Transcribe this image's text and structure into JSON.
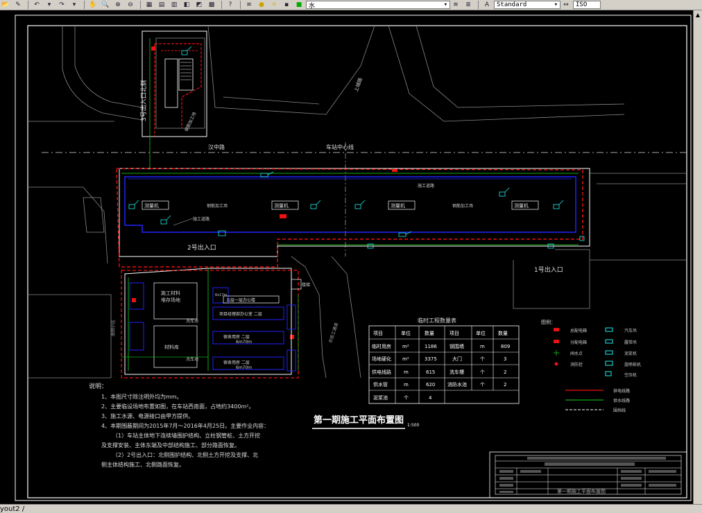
{
  "toolbar": {
    "layer_value": "水",
    "textstyle_value": "Standard",
    "dimstyle_value": "ISO",
    "icons": [
      "open-icon",
      "undo-icon",
      "redo-icon",
      "pan-icon",
      "zoom-realtime-icon",
      "zoom-window-icon",
      "zoom-previous-icon",
      "properties-icon",
      "design-center-icon",
      "tool-palettes-icon",
      "sheet-set-icon",
      "markup-icon",
      "calc-icon",
      "help-icon",
      "layer-manager-icon",
      "layer-state-icons",
      "layer-dropdown",
      "match-icon",
      "style-icon"
    ]
  },
  "status": {
    "layout_tab": "yout2"
  },
  "drawing": {
    "road_north": "汉中路",
    "station_center": "车站中心线",
    "road_east": "上城路",
    "exit3_label": "3号出入口北侧",
    "exit3_inner": "钢筋加工场",
    "exit2_label": "2号出入口",
    "exit1_label": "1号出入口",
    "west_label": "夹心墙区",
    "hall_label": "西侧出入口",
    "room_1": "测量机",
    "room_2": "测量机",
    "room_3": "测量机",
    "room_4": "测量机",
    "work_area_w": "钢筋加工场",
    "work_area_e": "钢筋加工场",
    "pipe_label_1": "施工道路",
    "pipe_label_2": "施工道路",
    "material_yard": "施工材料\n堆存场地",
    "material_store": "材料库",
    "car_wash": "洗车池",
    "office_title": "五层一层办公楼",
    "office_1": "项目经理部办公室 二层",
    "office_2": "宿舍用房   二层",
    "office_2_dim": "6m70m",
    "office_3": "宿舍用房   二层",
    "office_3_dim": "6m70m",
    "small_room": "6x17m",
    "gate_label": "大门",
    "stair": "楼梯",
    "side_label": "南侧小区",
    "road_side": "农民工通道",
    "east_shed": "工具房",
    "ramp": "斜坡道",
    "shed_left": "6m70m",
    "shed_mid": "6m70m"
  },
  "notes": {
    "title": "说明：",
    "items": [
      "1、本图尺寸除注明外均为mm。",
      "2、主要临设场地布置如图，在车站西南面，占地约3400m²。",
      "3、施工水源、电源接口由甲方提供。",
      "4、本期围蔽期间为2015年7月～2016年4月25日。主要作业内容：",
      "（1）车站主体地下连续墙围护结构、立柱钢管桩、土方开挖",
      "及支撑安装、主体东端及中部结构施工、部分路面恢复。",
      "（2）2号出入口：北侧围护结构、北侧土方开挖及支撑、北",
      "侧主体结构施工、北侧路面恢复。"
    ]
  },
  "main_title": "第一期施工平面布置图",
  "scale": "1:500",
  "table": {
    "title": "临时工程数量表",
    "headers": [
      "项目",
      "单位",
      "数量",
      "项目",
      "单位",
      "数量"
    ],
    "rows": [
      [
        "临时用房",
        "m²",
        "1186",
        "钢围墙",
        "m",
        "809"
      ],
      [
        "场地硬化",
        "m²",
        "3375",
        "大门",
        "个",
        "3"
      ],
      [
        "供电线路",
        "m",
        "615",
        "洗车槽",
        "个",
        "2"
      ],
      [
        "供水管",
        "m",
        "620",
        "消防水池",
        "个",
        "2"
      ],
      [
        "泥浆池",
        "个",
        "4",
        "",
        "",
        ""
      ]
    ]
  },
  "legend": {
    "title": "图例：",
    "items_left": [
      "总配电箱",
      "分配电箱",
      "阀水点",
      "消防栓"
    ],
    "items_right": [
      "汽车吊",
      "履带吊",
      "泥浆机",
      "旋喷桩机",
      "空压机"
    ],
    "lines": [
      "供电线路",
      "供水线路",
      "围挡线"
    ]
  },
  "titleblock": {
    "drawing_name": "第一期施工平面布置图"
  }
}
